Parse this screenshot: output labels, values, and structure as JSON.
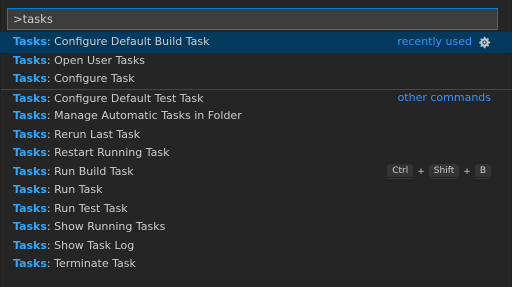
{
  "quick_input": {
    "value": ">tasks"
  },
  "prefix": "Tasks",
  "items": [
    {
      "label": ": Configure Default Build Task",
      "group": "recently used",
      "selected": true
    },
    {
      "label": ": Open User Tasks"
    },
    {
      "label": ": Configure Task"
    },
    {
      "label": ": Configure Default Test Task",
      "group": "other commands"
    },
    {
      "label": ": Manage Automatic Tasks in Folder"
    },
    {
      "label": ": Rerun Last Task"
    },
    {
      "label": ": Restart Running Task"
    },
    {
      "label": ": Run Build Task",
      "keybinding": [
        "Ctrl",
        "Shift",
        "B"
      ]
    },
    {
      "label": ": Run Task"
    },
    {
      "label": ": Run Test Task"
    },
    {
      "label": ": Show Running Tasks"
    },
    {
      "label": ": Show Task Log"
    },
    {
      "label": ": Terminate Task"
    }
  ],
  "keybinding_separator": "+",
  "icons": {
    "configure": "gear-icon"
  },
  "colors": {
    "highlight": "#2aaaff",
    "selection": "#04395e",
    "focus_border": "#007fd4",
    "group_label": "#3794ff"
  }
}
